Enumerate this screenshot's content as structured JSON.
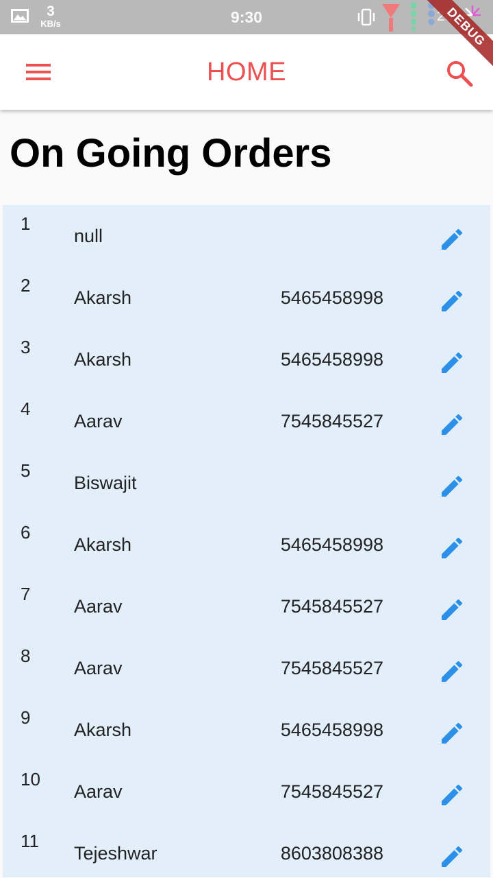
{
  "status_bar": {
    "speed_value": "3",
    "speed_unit": "KB/s",
    "time": "9:30",
    "battery": "28",
    "icons": [
      "image-icon",
      "vibrate-icon",
      "signal-icon",
      "battery-icon"
    ]
  },
  "debug_banner": "DEBUG",
  "app_bar": {
    "title": "HOME",
    "menu_icon": "menu-icon",
    "search_icon": "search-icon",
    "accent_color": "#ec5050"
  },
  "page": {
    "heading": "On Going Orders"
  },
  "orders": [
    {
      "num": "1",
      "name": "null",
      "phone": ""
    },
    {
      "num": "2",
      "name": "Akarsh",
      "phone": "5465458998"
    },
    {
      "num": "3",
      "name": "Akarsh",
      "phone": "5465458998"
    },
    {
      "num": "4",
      "name": "Aarav",
      "phone": "7545845527"
    },
    {
      "num": "5",
      "name": "Biswajit",
      "phone": ""
    },
    {
      "num": "6",
      "name": "Akarsh",
      "phone": "5465458998"
    },
    {
      "num": "7",
      "name": "Aarav",
      "phone": "7545845527"
    },
    {
      "num": "8",
      "name": "Aarav",
      "phone": "7545845527"
    },
    {
      "num": "9",
      "name": "Akarsh",
      "phone": "5465458998"
    },
    {
      "num": "10",
      "name": "Aarav",
      "phone": "7545845527"
    },
    {
      "num": "11",
      "name": "Tejeshwar",
      "phone": "8603808388"
    }
  ],
  "colors": {
    "list_background": "#e2effb",
    "edit_icon": "#2c8fe8"
  }
}
